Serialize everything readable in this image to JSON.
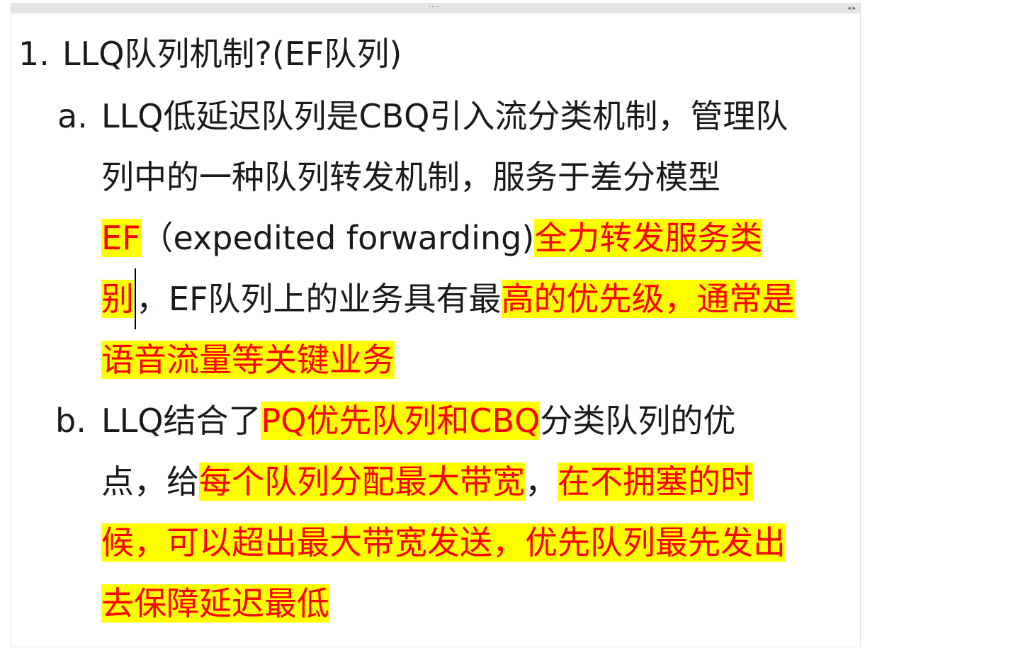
{
  "window": {
    "drag_handle": "····",
    "arrows": "◂ ▸"
  },
  "item1": {
    "marker": "1.",
    "text": "LLQ队列机制?(EF队列)"
  },
  "item_a": {
    "marker": "a.",
    "line1": "LLQ低延迟队列是CBQ引入流分类机制，管理队",
    "line2": "列中的一种队列转发机制，服务于差分模型",
    "line3_hl1": "EF",
    "line3_plain": "（expedited forwarding)",
    "line3_hl2": "全力转发服务类",
    "line4_hl1": "别",
    "line4_plain": "，EF队列上的业务具有最",
    "line4_hl2": "高的优先级，通常是",
    "line5_hl": "语音流量等关键业务"
  },
  "item_b": {
    "marker": "b.",
    "line1_plain1": "LLQ结合了",
    "line1_hl": "PQ优先队列和CBQ",
    "line1_plain2": "分类队列的优",
    "line2_plain1": "点，给",
    "line2_hl1": "每个队列分配最大带宽",
    "line2_plain2": "，",
    "line2_hl2": "在不拥塞的时",
    "line3_hl": "候，可以超出最大带宽发送，优先队列最先发出",
    "line4_hl": "去保障延迟最低"
  },
  "colors": {
    "highlight_bg": "#ffff00",
    "highlight_text": "#ff0000",
    "body_text": "#1a1a1a"
  }
}
